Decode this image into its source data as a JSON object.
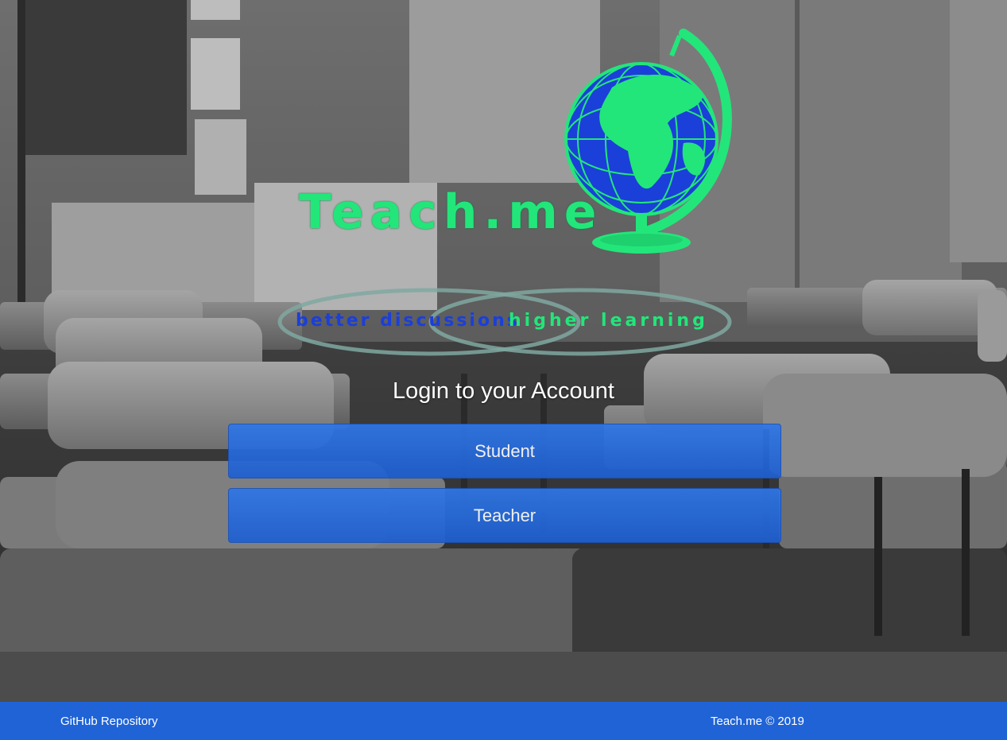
{
  "brand": {
    "name": "Teach.me",
    "tagline_left": "better discussions",
    "tagline_right": "higher learning",
    "colors": {
      "green": "#22e67a",
      "blue": "#1b3fd9"
    }
  },
  "login": {
    "title": "Login to your Account",
    "student_label": "Student",
    "teacher_label": "Teacher",
    "button_color": "#2f77e6"
  },
  "footer": {
    "link_label": "GitHub Repository",
    "copyright": "Teach.me © 2019",
    "color": "#1f63d6"
  },
  "icons": {
    "logo": "globe-icon"
  }
}
